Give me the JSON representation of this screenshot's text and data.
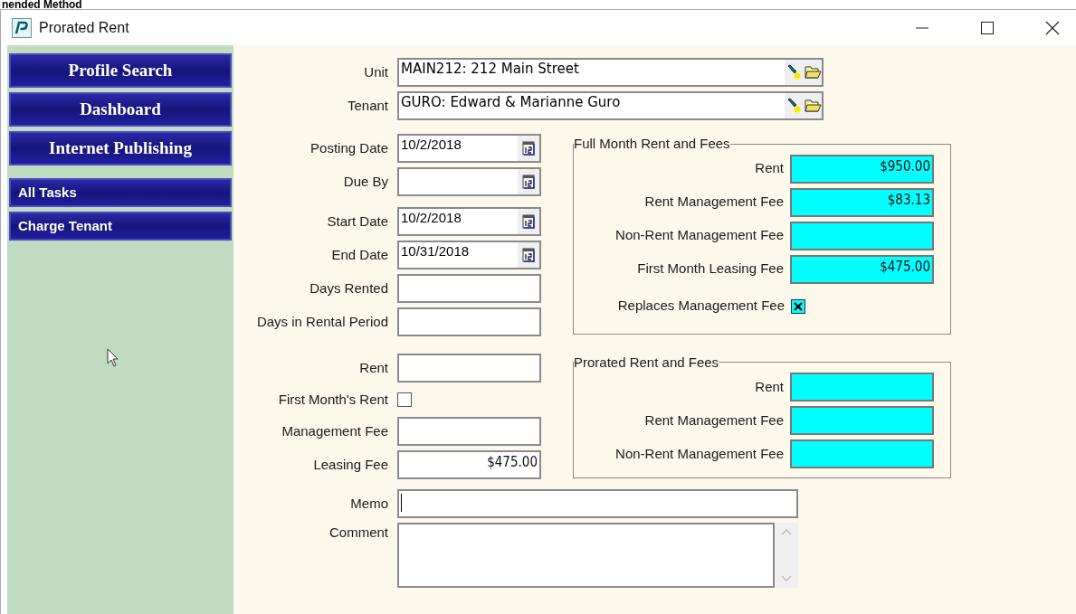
{
  "heading": "nended Method",
  "window": {
    "title": "Prorated Rent"
  },
  "sidebar": {
    "primary": [
      {
        "label": "Profile Search"
      },
      {
        "label": "Dashboard"
      },
      {
        "label": "Internet Publishing"
      }
    ],
    "tasks": [
      {
        "label": "All Tasks"
      },
      {
        "label": "Charge Tenant"
      }
    ]
  },
  "lookups": [
    {
      "label": "Unit",
      "value": "MAIN212: 212 Main Street"
    },
    {
      "label": "Tenant",
      "value": "GURO: Edward & Marianne Guro"
    }
  ],
  "left_groups": [
    {
      "fields": [
        {
          "kind": "date",
          "label": "Posting Date",
          "value": "10/2/2018"
        },
        {
          "kind": "date",
          "label": "Due By"
        }
      ]
    },
    {
      "fields": [
        {
          "kind": "date",
          "label": "Start Date",
          "value": "10/2/2018"
        },
        {
          "kind": "date",
          "label": "End Date",
          "value": "10/31/2018"
        },
        {
          "kind": "text",
          "label": "Days Rented"
        },
        {
          "kind": "text",
          "label": "Days in Rental Period"
        }
      ]
    },
    {
      "fields": [
        {
          "kind": "text",
          "label": "Rent"
        },
        {
          "kind": "checkbox",
          "label": "First Month's Rent",
          "checked": false,
          "readonly": false
        },
        {
          "kind": "text",
          "label": "Management Fee"
        },
        {
          "kind": "text",
          "label": "Leasing Fee",
          "value": "$475.00"
        }
      ]
    }
  ],
  "right_groups": [
    {
      "title": "Full Month Rent and Fees",
      "fields": [
        {
          "kind": "text",
          "label": "Rent",
          "value": "$950.00",
          "readonly": true
        },
        {
          "kind": "text",
          "label": "Rent Management Fee",
          "value": "$83.13",
          "readonly": true
        },
        {
          "kind": "text",
          "label": "Non-Rent Management Fee",
          "readonly": true
        },
        {
          "kind": "text",
          "label": "First Month Leasing Fee",
          "value": "$475.00",
          "readonly": true
        },
        {
          "kind": "checkbox",
          "label": "Replaces Management Fee",
          "checked": true,
          "readonly": true
        }
      ]
    },
    {
      "title": "Prorated Rent and Fees",
      "fields": [
        {
          "kind": "text",
          "label": "Rent",
          "readonly": true
        },
        {
          "kind": "text",
          "label": "Rent Management Fee",
          "readonly": true
        },
        {
          "kind": "text",
          "label": "Non-Rent Management Fee",
          "readonly": true
        }
      ]
    }
  ],
  "memo": {
    "label": "Memo",
    "focused": true
  },
  "comment": {
    "label": "Comment"
  }
}
